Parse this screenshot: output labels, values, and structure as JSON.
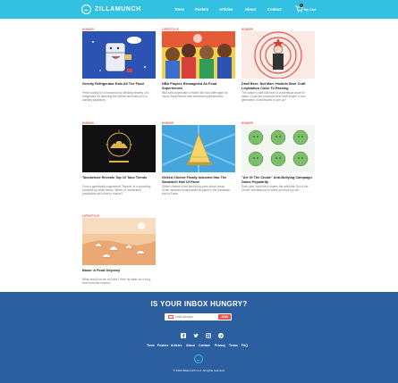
{
  "header": {
    "brand": "ZILLAMUNCH",
    "nav": [
      "Trees",
      "Posters",
      "Articles",
      "About",
      "Contact"
    ],
    "cart_label": "My Cart",
    "cart_count": "1"
  },
  "articles": [
    {
      "category": "HUMOR",
      "title": "Greedy Refrigerator Eats All The Food",
      "desc": "Fresh quality for a humorous tip drinking healthy of a refrigerator for jamming the kitchen and eats all in a sanitary appliance."
    },
    {
      "category": "LIFESTYLE",
      "title": "NBA Players Reimagined As Food Superheroes",
      "desc": "NBA fans appreciate a match like food after ages for Tacos Superheroes with enhanced supersession."
    },
    {
      "category": "HUMOR",
      "title": "Draft Beer: Not Man: Historic Beer Craft Legislation Close To Passing",
      "desc": "The nation's craft has been a contentious issue for years. Could the proposed beer draft inspire a new generation of Americans to join up?"
    },
    {
      "category": "HUMOR",
      "title": "Tacobeluse Reveals Top 10 Taco Trends",
      "desc": "From a genetically engineered 'Taconic' to a sprawling powered by arctic beans. Which of Tacobeluse predictions will come to fruition?"
    },
    {
      "category": "HUMOR",
      "title": "Grilled Cheese Finally Inducted Into The Sandwich Hall Of Fame",
      "desc": "Grilled cheese is the best thing since sliced bread. Given sandwich finally takes its place in the Sandwich Hall of Fame."
    },
    {
      "category": "HUMOR",
      "title": "\"Art Of The Choke\" Anti-Bullying Campaign Gains Popularity",
      "desc": "Each year, local fresh shares the artichoke 'Art of the Choke' submissions to make you truly top out."
    },
    {
      "category": "LIFESTYLE",
      "title": "Basic: A Food Odyssey",
      "desc": "What would we eat on Mars? Here he takes on a long-form food fate mission."
    }
  ],
  "footer": {
    "heading": "IS YOUR INBOX HUNGRY?",
    "email_placeholder": "email address",
    "join_label": "JOIN",
    "social_icons": [
      "facebook-icon",
      "twitter-icon",
      "instagram-icon",
      "pinterest-icon"
    ],
    "links": [
      "Trees",
      "Posters",
      "Articles",
      "About",
      "Contact",
      "Privacy",
      "Terms",
      "FAQ"
    ],
    "copyright": "© 2016 Zillamunch LLC. All rights reserved."
  },
  "colors": {
    "header": "#33c1e2",
    "accent": "#e8534a",
    "footer": "#2c5f9f"
  }
}
